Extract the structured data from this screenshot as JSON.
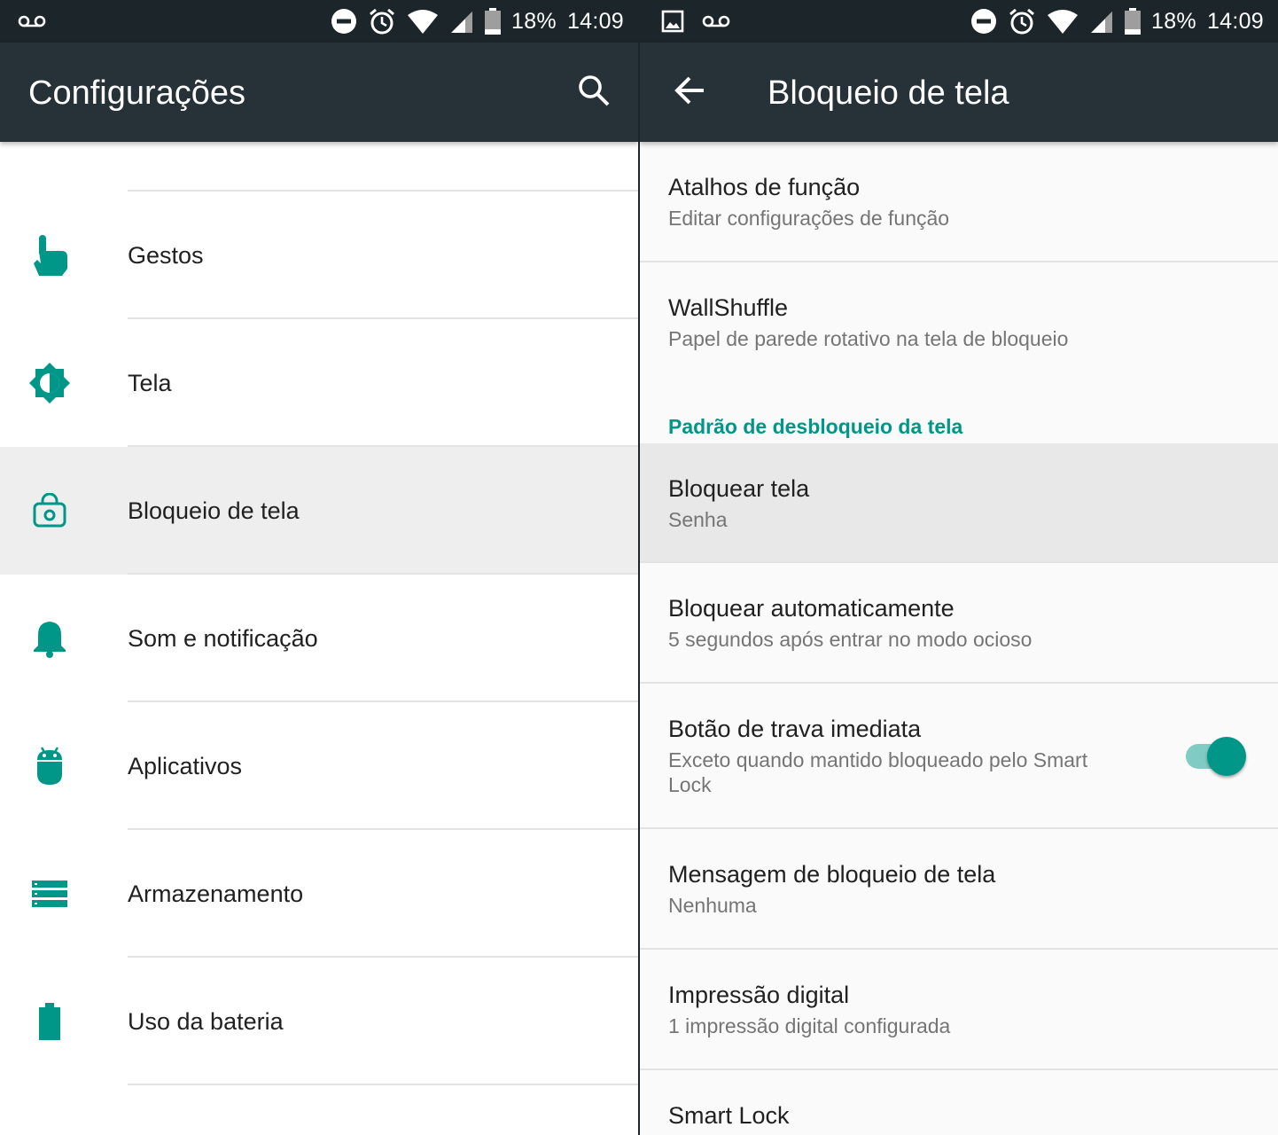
{
  "colors": {
    "accent": "#009688",
    "toolbar": "#263238",
    "statusbar": "#1c2529",
    "toggle_track": "#80cbc4"
  },
  "left": {
    "status_bar": {
      "battery": "18%",
      "time": "14:09"
    },
    "toolbar": {
      "title": "Configurações"
    },
    "items": [
      {
        "label": "Gestos",
        "icon": "gesture-hand-icon"
      },
      {
        "label": "Tela",
        "icon": "brightness-icon"
      },
      {
        "label": "Bloqueio de tela",
        "icon": "lock-screen-icon",
        "selected": true
      },
      {
        "label": "Som e notificação",
        "icon": "bell-icon"
      },
      {
        "label": "Aplicativos",
        "icon": "android-icon"
      },
      {
        "label": "Armazenamento",
        "icon": "storage-icon"
      },
      {
        "label": "Uso da bateria",
        "icon": "battery-icon"
      }
    ]
  },
  "right": {
    "status_bar": {
      "battery": "18%",
      "time": "14:09"
    },
    "toolbar": {
      "title": "Bloqueio de tela"
    },
    "items": {
      "atalhos": {
        "title": "Atalhos de função",
        "subtitle": "Editar configurações de função"
      },
      "wallshuffle": {
        "title": "WallShuffle",
        "subtitle": "Papel de parede rotativo na tela de bloqueio"
      },
      "section_header": "Padrão de desbloqueio da tela",
      "bloquear_tela": {
        "title": "Bloquear tela",
        "subtitle": "Senha"
      },
      "bloquear_auto": {
        "title": "Bloquear automaticamente",
        "subtitle": "5 segundos após entrar no modo ocioso"
      },
      "botao_trava": {
        "title": "Botão de trava imediata",
        "subtitle": "Exceto quando mantido bloqueado pelo Smart Lock",
        "toggle_on": true
      },
      "mensagem": {
        "title": "Mensagem de bloqueio de tela",
        "subtitle": "Nenhuma"
      },
      "impressao": {
        "title": "Impressão digital",
        "subtitle": "1 impressão digital configurada"
      },
      "smart_lock": {
        "title": "Smart Lock"
      }
    }
  }
}
